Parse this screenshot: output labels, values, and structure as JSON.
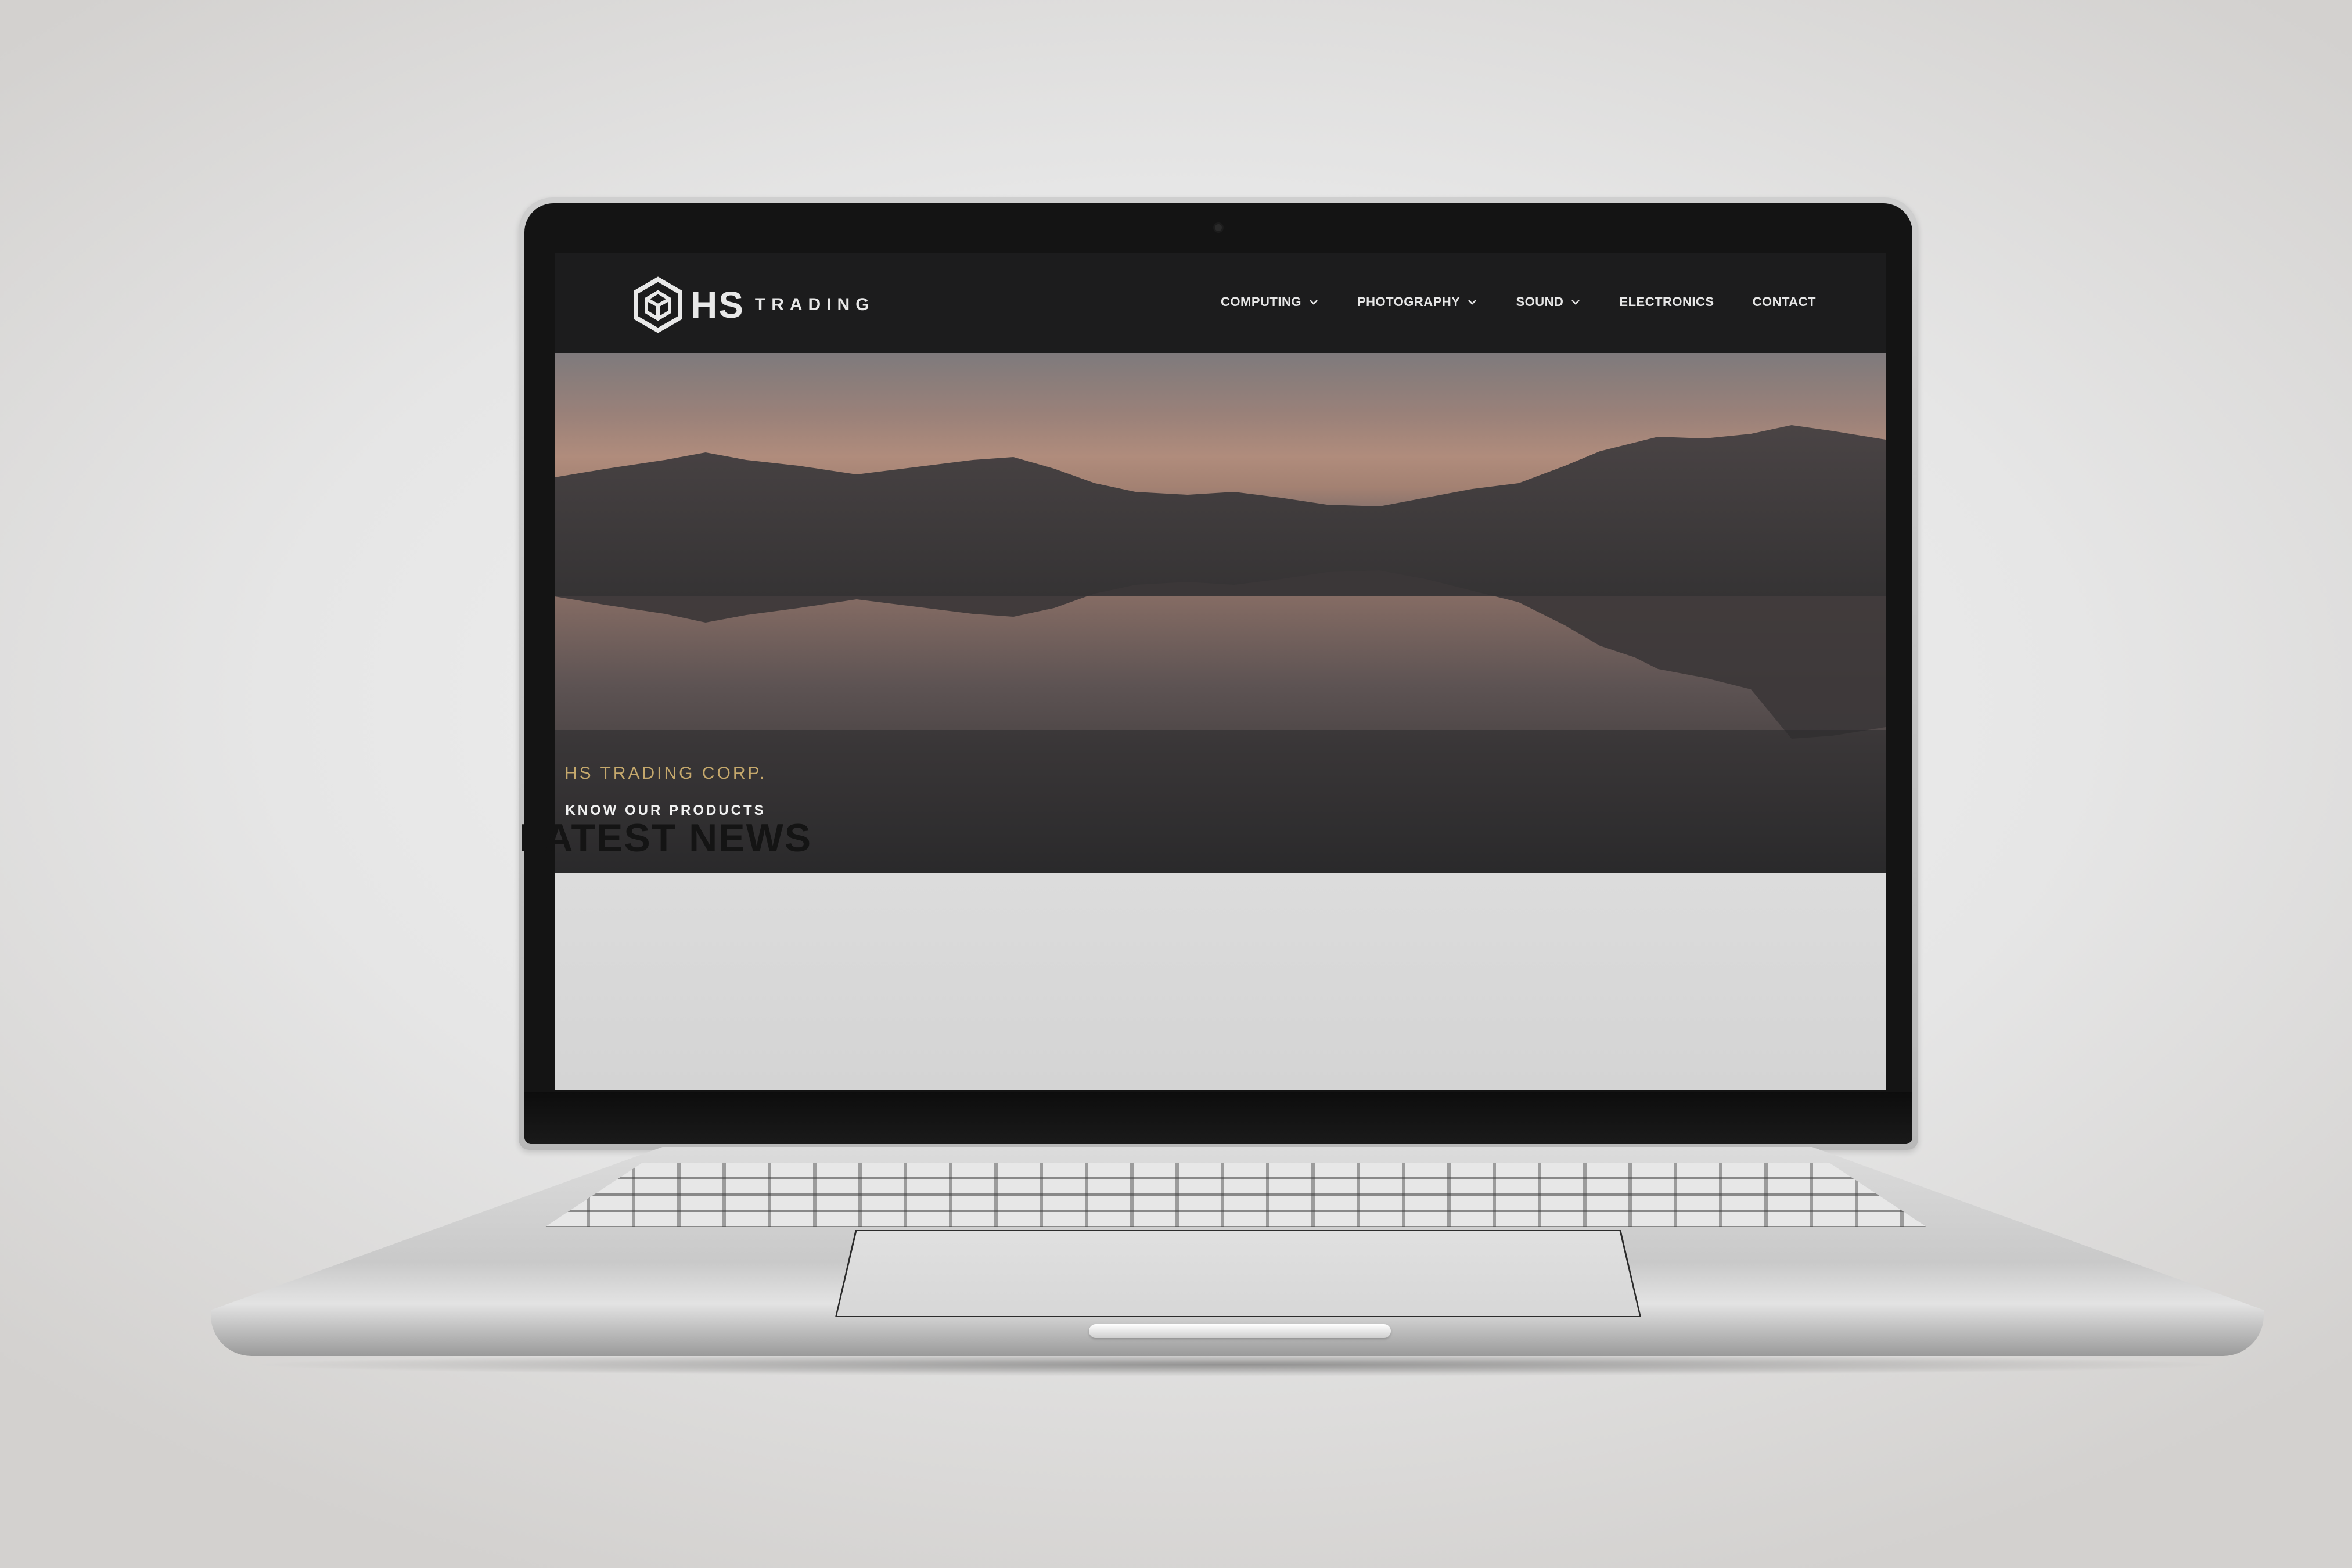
{
  "site": {
    "logo_mark": "HS",
    "logo_word": "TRADING",
    "logo_icon": "hexagon-cube-icon"
  },
  "nav": {
    "items": [
      {
        "label": "COMPUTING",
        "has_dropdown": true
      },
      {
        "label": "PHOTOGRAPHY",
        "has_dropdown": true
      },
      {
        "label": "SOUND",
        "has_dropdown": true
      },
      {
        "label": "ELECTRONICS",
        "has_dropdown": false
      },
      {
        "label": "CONTACT",
        "has_dropdown": false
      }
    ]
  },
  "hero": {
    "cta_label": "KNOW OUR PRODUCTS",
    "image": "mountain-lake-reflection-at-dusk"
  },
  "section": {
    "eyebrow": "HS TRADING CORP.",
    "title": "LATEST NEWS"
  },
  "colors": {
    "header_bg": "#1c1c1d",
    "nav_text": "#e6e6e6",
    "accent_gold": "#c5a86c",
    "content_bg": "#d9d9d9",
    "title_text": "#141414"
  }
}
